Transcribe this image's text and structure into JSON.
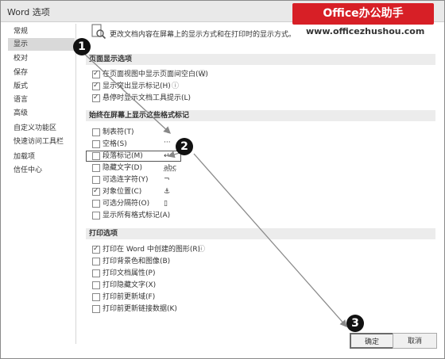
{
  "window": {
    "title": "Word 选项"
  },
  "brand": {
    "label": "Office办公助手",
    "url": "www.officezhushou.com",
    "color": "#d71f26"
  },
  "sidebar": {
    "items": [
      {
        "label": "常规"
      },
      {
        "label": "显示",
        "selected": true
      },
      {
        "label": "校对"
      },
      {
        "label": "保存"
      },
      {
        "label": "版式"
      },
      {
        "label": "语言"
      },
      {
        "label": "高级"
      },
      {
        "label": "自定义功能区"
      },
      {
        "label": "快速访问工具栏"
      },
      {
        "label": "加载项"
      },
      {
        "label": "信任中心"
      }
    ]
  },
  "header": {
    "text": "更改文档内容在屏幕上的显示方式和在打印时的显示方式。",
    "icon": "document-magnifier-icon"
  },
  "sections": {
    "page_display": {
      "title": "页面显示选项",
      "options": [
        {
          "label": "在页面视图中显示页面间空白(W)",
          "checked": true,
          "info": "ⓘ"
        },
        {
          "label": "显示突出显示标记(H)",
          "checked": true,
          "info": "ⓘ"
        },
        {
          "label": "悬停时显示文档工具提示(L)",
          "checked": true
        }
      ]
    },
    "format_marks": {
      "title": "始终在屏幕上显示这些格式标记",
      "options": [
        {
          "label": "制表符(T)",
          "checked": false,
          "symbol": "→"
        },
        {
          "label": "空格(S)",
          "checked": false,
          "symbol": "···"
        },
        {
          "label": "段落标记(M)",
          "checked": false,
          "symbol": "↵"
        },
        {
          "label": "隐藏文字(D)",
          "checked": false,
          "symbol": "abc"
        },
        {
          "label": "可选连字符(Y)",
          "checked": false,
          "symbol": "¬"
        },
        {
          "label": "对象位置(C)",
          "checked": true,
          "symbol": "⚓"
        },
        {
          "label": "可选分隔符(O)",
          "checked": false,
          "symbol": "▯"
        },
        {
          "label": "显示所有格式标记(A)",
          "checked": false
        }
      ]
    },
    "print": {
      "title": "打印选项",
      "options": [
        {
          "label": "打印在 Word 中创建的图形(R)",
          "checked": true,
          "info": "ⓘ"
        },
        {
          "label": "打印背景色和图像(B)",
          "checked": false
        },
        {
          "label": "打印文档属性(P)",
          "checked": false
        },
        {
          "label": "打印隐藏文字(X)",
          "checked": false
        },
        {
          "label": "打印前更新域(F)",
          "checked": false
        },
        {
          "label": "打印前更新链接数据(K)",
          "checked": false
        }
      ]
    }
  },
  "buttons": {
    "ok": "确定",
    "cancel": "取消"
  },
  "callouts": {
    "one": "1",
    "two": "2",
    "three": "3"
  }
}
